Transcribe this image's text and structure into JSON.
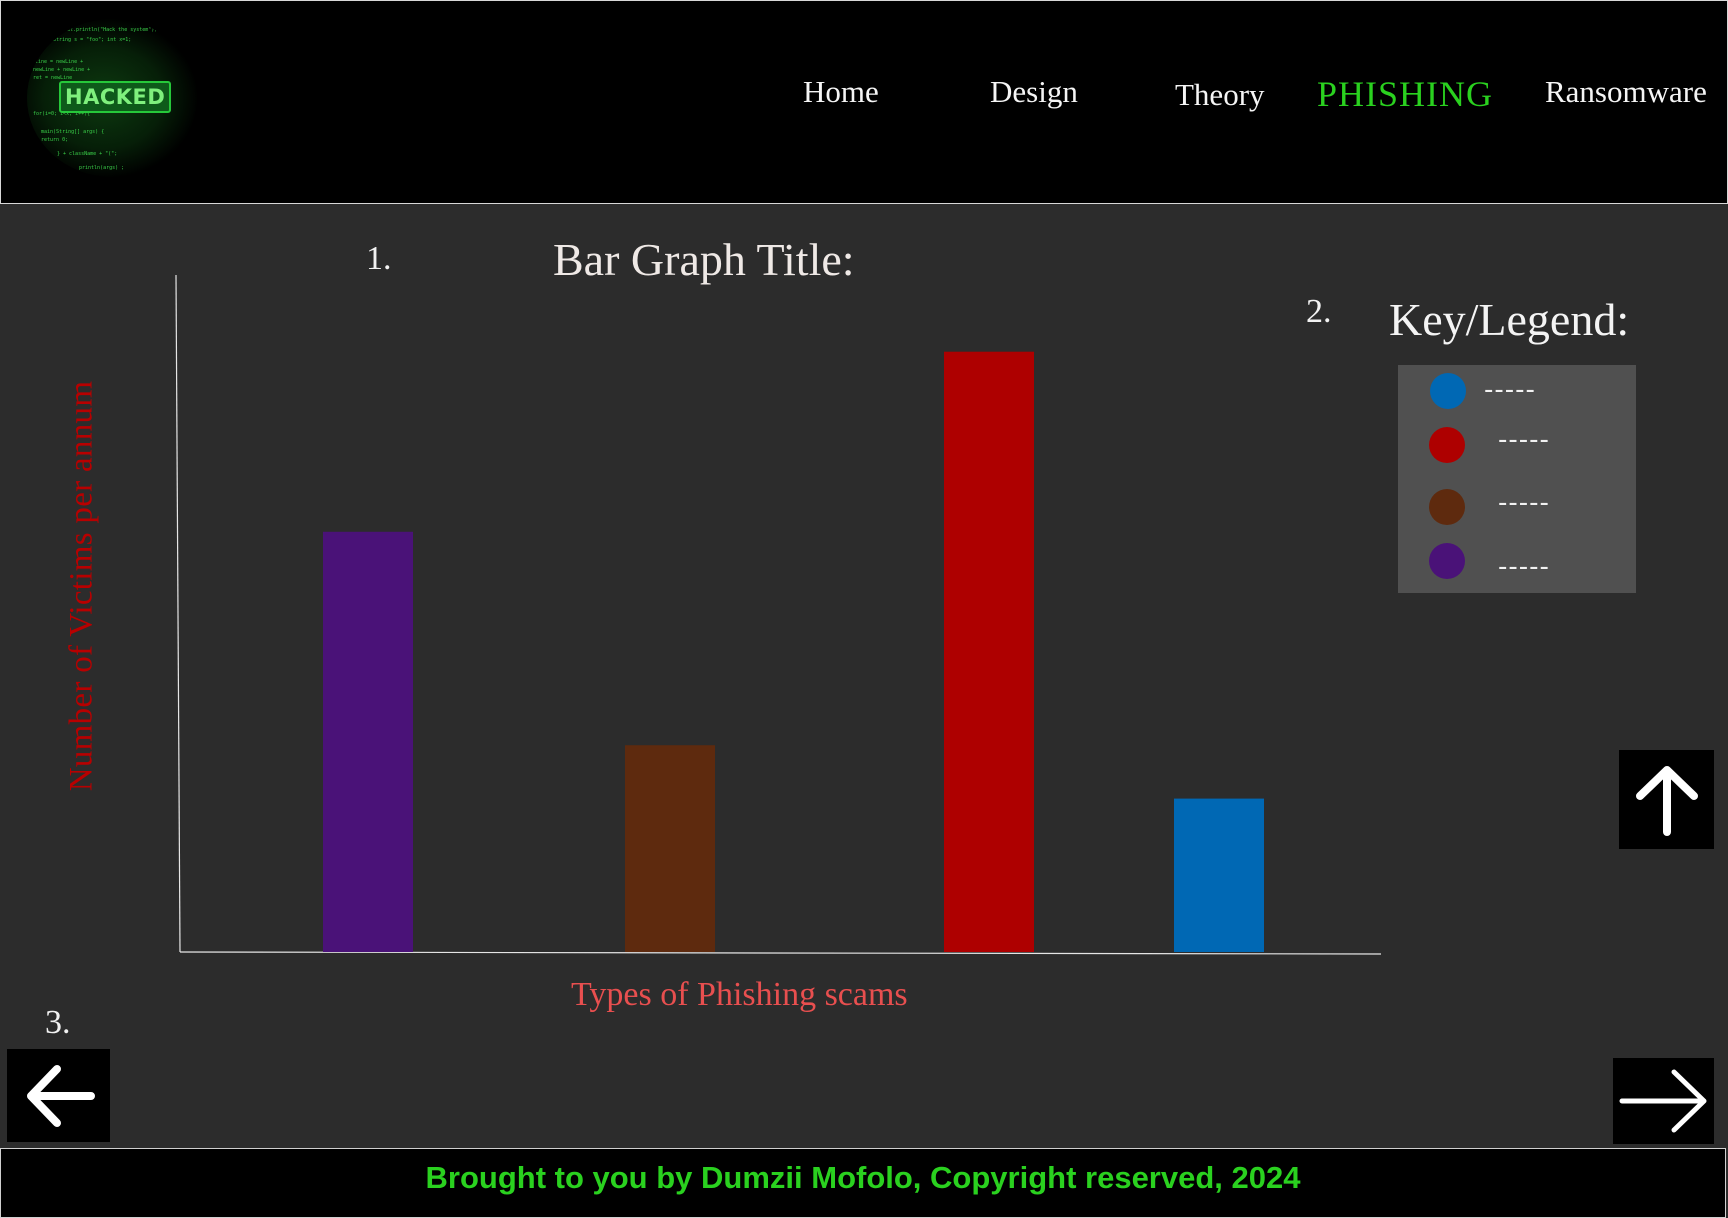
{
  "header": {
    "logo_text": "HACKED",
    "nav": [
      {
        "label": "Home"
      },
      {
        "label": "Design"
      },
      {
        "label": "Theory"
      },
      {
        "label": "PHISHING",
        "active": true
      },
      {
        "label": "Ransomware"
      }
    ]
  },
  "markers": {
    "chart": "1.",
    "legend": "2.",
    "nav": "3."
  },
  "chart_data": {
    "type": "bar",
    "title": "Bar Graph Title:",
    "xlabel": "Types of Phishing scams",
    "ylabel": "Number of Victims per annum",
    "categories": [
      "",
      "",
      "",
      ""
    ],
    "values": [
      63,
      31,
      90,
      23
    ],
    "colors": [
      "#4a1278",
      "#5e2a0e",
      "#ae0000",
      "#0068b4"
    ],
    "ylim": [
      0,
      100
    ],
    "grid": false,
    "legend_placement": "right"
  },
  "legend": {
    "title": "Key/Legend:",
    "items": [
      {
        "color": "#0068b4",
        "label": "-----"
      },
      {
        "color": "#ae0000",
        "label": "-----"
      },
      {
        "color": "#5e2a0e",
        "label": "-----"
      },
      {
        "color": "#4a1278",
        "label": "-----"
      }
    ]
  },
  "buttons": {
    "up_icon": "arrow-up-icon",
    "back_icon": "arrow-left-icon",
    "next_icon": "arrow-right-icon"
  },
  "footer": {
    "text": "Brought to you by Dumzii Mofolo, Copyright reserved, 2024"
  }
}
